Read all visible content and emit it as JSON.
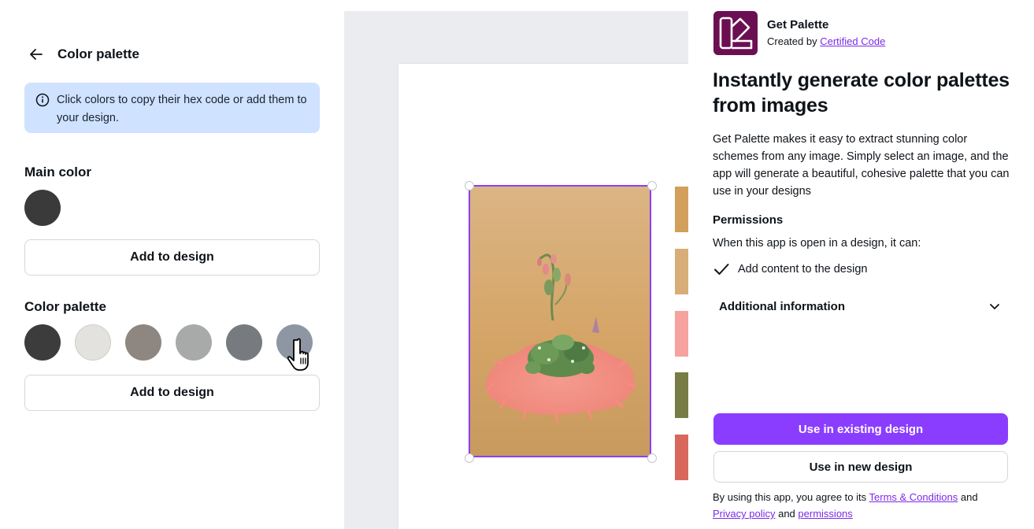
{
  "left_panel": {
    "title": "Color palette",
    "info_text": "Click colors to copy their hex code or add them to your design.",
    "main_color_label": "Main color",
    "main_color": "#3a3a3a",
    "add_main_label": "Add to design",
    "palette_label": "Color palette",
    "palette_colors": [
      "#3c3c3c",
      "#e3e2df",
      "#8d8681",
      "#a7aaa9",
      "#777b7f",
      "#8e96a4"
    ],
    "add_palette_label": "Add to design"
  },
  "canvas": {
    "palette_squares": [
      "#d2a05a",
      "#d8ad77",
      "#f6a29f",
      "#787c45",
      "#d9685c"
    ],
    "selection_color": "#8b3dff"
  },
  "right_panel": {
    "app_name": "Get Palette",
    "created_by_prefix": "Created by",
    "creator": "Certified Code",
    "headline": "Instantly generate color palettes from images",
    "description": "Get Palette makes it easy to extract stunning color schemes from any image. Simply select an image, and the app will generate a beautiful, cohesive palette that you can use in your designs",
    "permissions_title": "Permissions",
    "permissions_intro": "When this app is open in a design, it can:",
    "permission_item": "Add content to the design",
    "additional_info": "Additional information",
    "primary_button": "Use in existing design",
    "secondary_button": "Use in new design",
    "terms_prefix": "By using this app, you agree to its",
    "terms_link": "Terms & Conditions",
    "terms_and": "and",
    "privacy_link": "Privacy policy",
    "terms_and2": "and",
    "permissions_link": "permissions",
    "accent_color": "#8b3dff",
    "logo_color": "#6b0f52"
  }
}
